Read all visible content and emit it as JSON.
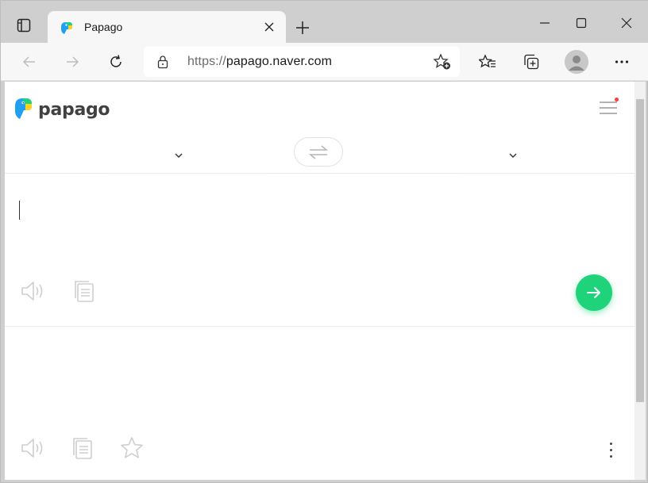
{
  "browser": {
    "tab": {
      "title": "Papago",
      "favicon": "papago-parrot-icon"
    },
    "address_bar": {
      "url_scheme": "https://",
      "url_host": "papago.naver.com"
    },
    "icons": {
      "tab_actions": "tab-actions-icon",
      "close_tab": "close-icon",
      "new_tab": "plus-icon",
      "minimize": "minimize-icon",
      "maximize": "maximize-icon",
      "close_window": "close-icon",
      "back": "back-arrow-icon",
      "forward": "forward-arrow-icon",
      "refresh": "refresh-icon",
      "lock": "lock-icon",
      "add_favorite": "star-plus-icon",
      "favorites": "favorites-icon",
      "collections": "collections-icon",
      "profile": "profile-icon",
      "settings_more": "ellipsis-icon"
    }
  },
  "page": {
    "logo_text": "papago",
    "source": {
      "text": ""
    },
    "target": {
      "text": ""
    },
    "colors": {
      "accent": "#1ed37a",
      "notification_dot": "#ff3b3b",
      "logo_text": "#404040"
    }
  }
}
